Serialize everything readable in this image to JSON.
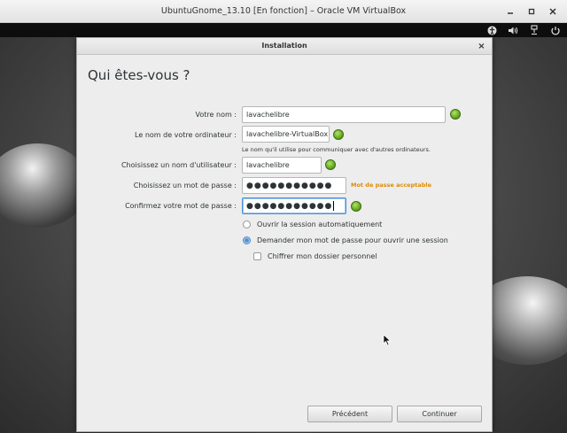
{
  "host_window": {
    "title": "UbuntuGnome_13.10 [En fonction] – Oracle VM VirtualBox",
    "controls": [
      "minimize-icon",
      "maximize-icon",
      "close-icon"
    ]
  },
  "guest_tray": {
    "icons": [
      "accessibility-icon",
      "volume-icon",
      "power-icon",
      "system-menu-icon"
    ]
  },
  "dialog": {
    "title": "Installation",
    "close_label": "×",
    "heading": "Qui êtes-vous ?",
    "fields": {
      "name": {
        "label": "Votre nom :",
        "value": "lavachelibre"
      },
      "computer": {
        "label": "Le nom de votre ordinateur :",
        "value": "lavachelibre-VirtualBox",
        "hint": "Le nom qu'il utilise pour communiquer avec d'autres ordinateurs."
      },
      "username": {
        "label": "Choisissez un nom d'utilisateur :",
        "value": "lavachelibre"
      },
      "password": {
        "label": "Choisissez un mot de passe :",
        "value": "●●●●●●●●●●●",
        "strength": "Mot de passe acceptable",
        "strength_color": "#e08a00"
      },
      "confirm": {
        "label": "Confirmez votre mot de passe :",
        "value": "●●●●●●●●●●●"
      }
    },
    "options": {
      "auto_login": {
        "label": "Ouvrir la session automatiquement",
        "checked": false
      },
      "ask_password": {
        "label": "Demander mon mot de passe pour ouvrir une session",
        "checked": true
      },
      "encrypt_home": {
        "label": "Chiffrer mon dossier personnel",
        "checked": false
      }
    },
    "buttons": {
      "back": "Précédent",
      "continue": "Continuer"
    },
    "valid_color": "#6cae25",
    "accent_color": "#4a90d9"
  }
}
